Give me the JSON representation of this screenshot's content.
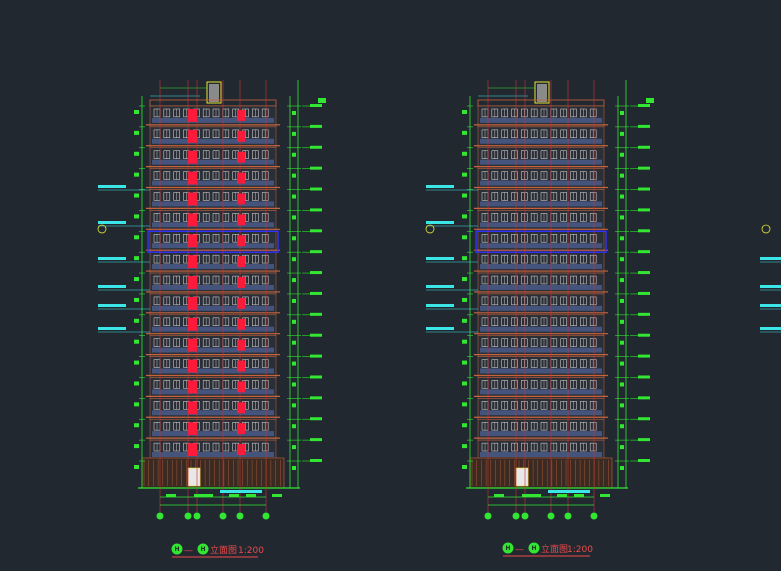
{
  "drawings": [
    {
      "id": "left",
      "axis_start": "H",
      "axis_end": "H",
      "dash": "—",
      "title": "立面图",
      "scale": "1:200",
      "variant": "red-balconies"
    },
    {
      "id": "right",
      "axis_start": "H",
      "axis_end": "H",
      "dash": "—",
      "title": "立面图",
      "scale": "1:200",
      "variant": "plain"
    }
  ],
  "colors": {
    "background": "#212830",
    "facade_orange": "#c8643c",
    "balcony_red": "#ff1a3c",
    "window_white": "#e8e8e8",
    "dimension_green": "#32e632",
    "annotation_cyan": "#3ce6e6",
    "axis_yellow": "#e6e632",
    "highlight_blue": "#3232ff"
  }
}
